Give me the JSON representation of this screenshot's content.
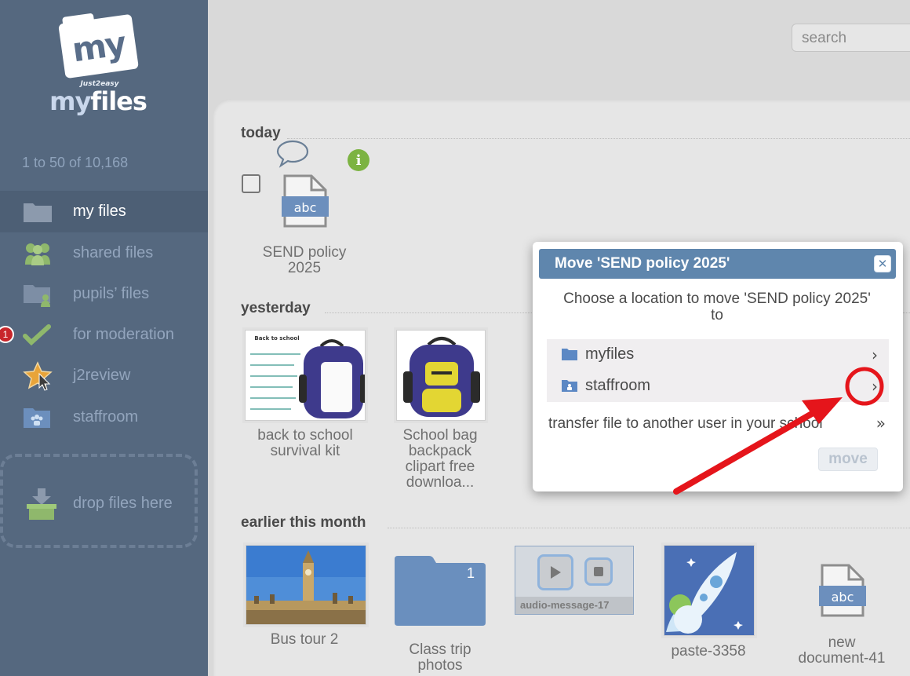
{
  "app": {
    "logo_top": "my",
    "logo_small": "Just2easy",
    "logo_my": "my",
    "logo_files": "files"
  },
  "sidebar": {
    "count": "1 to 50 of 10,168",
    "items": [
      {
        "label": "my files",
        "icon": "folder-icon"
      },
      {
        "label": "shared files",
        "icon": "users-icon"
      },
      {
        "label": "pupils’ files",
        "icon": "pupil-folder-icon"
      },
      {
        "label": "for moderation",
        "icon": "checkmark-icon",
        "badge": "1"
      },
      {
        "label": "j2review",
        "icon": "star-cursor-icon"
      },
      {
        "label": "staffroom",
        "icon": "staffroom-folder-icon"
      }
    ],
    "drop_label": "drop files here"
  },
  "search": {
    "placeholder": "search"
  },
  "sections": {
    "today": "today",
    "yesterday": "yesterday",
    "earlier": "earlier this month"
  },
  "files": {
    "today": [
      {
        "name_line1": "SEND policy",
        "name_line2": "2025",
        "icon_text": "abc"
      }
    ],
    "yesterday": [
      {
        "name_line1": "back to school",
        "name_line2": "survival kit",
        "thumb_title": "Back to school"
      },
      {
        "name_line1": "School bag",
        "name_line2": "backpack",
        "name_line3": "clipart free",
        "name_line4": "downloa..."
      }
    ],
    "earlier": [
      {
        "name_line1": "Bus tour 2"
      },
      {
        "name_line1": "Class trip",
        "name_line2": "photos",
        "folder_count": "1"
      },
      {
        "name_line1": "audio-message-17"
      },
      {
        "name_line1": "paste-3358"
      },
      {
        "name_line1": "new",
        "name_line2": "document-41",
        "icon_text": "abc"
      }
    ]
  },
  "modal": {
    "title": "Move 'SEND policy 2025'",
    "text": "Choose a location to move 'SEND policy 2025' to",
    "locations": [
      {
        "label": "myfiles"
      },
      {
        "label": "staffroom"
      }
    ],
    "transfer": "transfer file to another user in your school",
    "move": "move"
  },
  "colors": {
    "sidebar": "#55687f",
    "modal_header": "#5f86ad",
    "annotation": "#e5151b",
    "info_green": "#7cb342"
  }
}
